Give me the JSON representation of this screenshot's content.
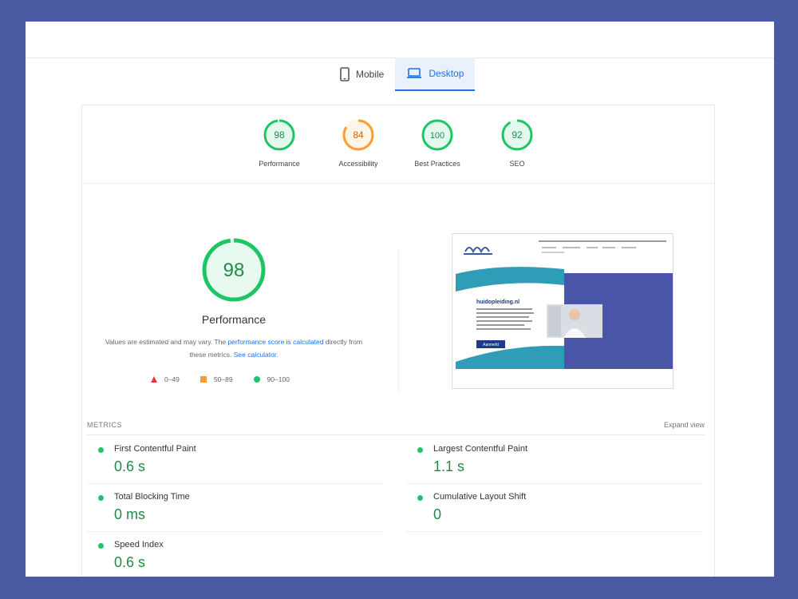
{
  "tabs": [
    {
      "label": "Mobile",
      "icon": "phone-icon",
      "active": false
    },
    {
      "label": "Desktop",
      "icon": "laptop-icon",
      "active": true
    }
  ],
  "scores": [
    {
      "label": "Performance",
      "value": "98",
      "status": "good"
    },
    {
      "label": "Accessibility",
      "value": "84",
      "status": "average"
    },
    {
      "label": "Best Practices",
      "value": "100",
      "status": "good"
    },
    {
      "label": "SEO",
      "value": "92",
      "status": "good"
    }
  ],
  "main": {
    "score": "98",
    "title": "Performance",
    "note_prefix": "Values are estimated and may vary. The ",
    "note_link1": "performance score is calculated",
    "note_middle": " directly from these metrics. ",
    "note_link2": "See calculator."
  },
  "legend": [
    {
      "label": "0–49",
      "shape": "triangle",
      "color": "#e53935"
    },
    {
      "label": "50–89",
      "shape": "square",
      "color": "#fb9c33"
    },
    {
      "label": "90–100",
      "shape": "circle",
      "color": "#1ec567"
    }
  ],
  "screenshot": {
    "heading": "huidopleiding.nl",
    "cta": "Aanmeld"
  },
  "metrics": {
    "label": "METRICS",
    "expand": "Expand view",
    "items": [
      {
        "name": "First Contentful Paint",
        "value": "0.6 s"
      },
      {
        "name": "Largest Contentful Paint",
        "value": "1.1 s"
      },
      {
        "name": "Total Blocking Time",
        "value": "0 ms"
      },
      {
        "name": "Cumulative Layout Shift",
        "value": "0"
      },
      {
        "name": "Speed Index",
        "value": "0.6 s"
      }
    ]
  },
  "colors": {
    "good": "#1ec567",
    "good_text": "#1e8c47",
    "average": "#fb9c33",
    "average_text": "#c3690b",
    "poor": "#e53935",
    "link": "#1a73e8",
    "page_bg": "#4a5aa3"
  }
}
